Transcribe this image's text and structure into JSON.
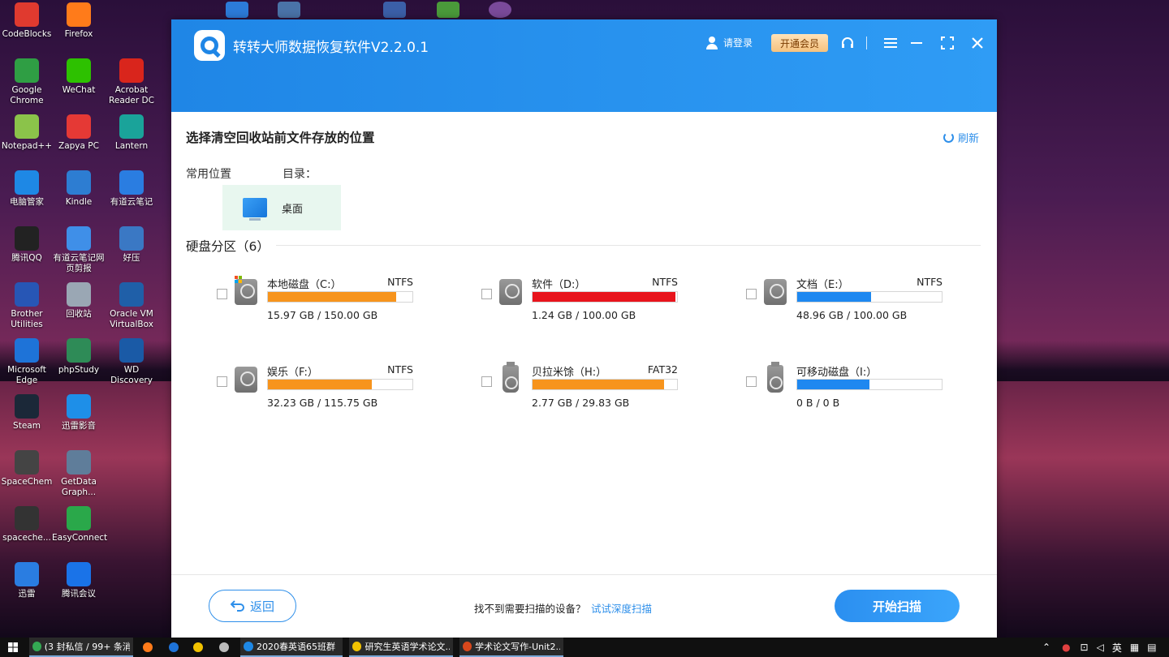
{
  "desktop": {
    "icons": [
      {
        "label": "CodeBlocks",
        "color": "#e03a2f"
      },
      {
        "label": "Firefox",
        "color": "#ff7b1a"
      },
      {
        "label": "Google Chrome",
        "color": "#2f9e44"
      },
      {
        "label": "WeChat",
        "color": "#2dc100"
      },
      {
        "label": "Acrobat Reader DC",
        "color": "#d9251c"
      },
      {
        "label": "Notepad++",
        "color": "#8bc34a"
      },
      {
        "label": "Zapya PC",
        "color": "#e53935"
      },
      {
        "label": "Lantern",
        "color": "#1aa39a"
      },
      {
        "label": "电脑管家",
        "color": "#1e88e5"
      },
      {
        "label": "Kindle",
        "color": "#2d7dd2"
      },
      {
        "label": "有道云笔记",
        "color": "#2a7de1"
      },
      {
        "label": "腾讯QQ",
        "color": "#222222"
      },
      {
        "label": "有道云笔记网页剪报",
        "color": "#3f8fe8"
      },
      {
        "label": "好压",
        "color": "#3a78c4"
      },
      {
        "label": "Brother Utilities",
        "color": "#2756b5"
      },
      {
        "label": "回收站",
        "color": "#9aa7b4"
      },
      {
        "label": "Oracle VM VirtualBox",
        "color": "#1f5fa8"
      },
      {
        "label": "Microsoft Edge",
        "color": "#1e73d8"
      },
      {
        "label": "phpStudy",
        "color": "#2e8b57"
      },
      {
        "label": "WD Discovery",
        "color": "#1a5aa6"
      },
      {
        "label": "Steam",
        "color": "#1b2838"
      },
      {
        "label": "迅雷影音",
        "color": "#1e8fe8"
      },
      {
        "label": "SpaceChem",
        "color": "#444444"
      },
      {
        "label": "GetData Graph...",
        "color": "#5f7d9a"
      },
      {
        "label": "spaceche...",
        "color": "#333333"
      },
      {
        "label": "EasyConnect",
        "color": "#2aa84a"
      },
      {
        "label": "迅雷",
        "color": "#2a7de1"
      },
      {
        "label": "腾讯会议",
        "color": "#1a73e8"
      }
    ]
  },
  "app": {
    "title": "转转大师数据恢复软件V2.2.0.1",
    "login_label": "请登录",
    "vip_label": "开通会员",
    "section_title": "选择清空回收站前文件存放的位置",
    "refresh_label": "刷新",
    "common_label": "常用位置",
    "dir_label": "目录：",
    "desktop_tile": "桌面",
    "disk_header": "硬盘分区（6）",
    "drives": [
      {
        "name": "本地磁盘（C:）",
        "fs": "NTFS",
        "size": "15.97 GB / 150.00 GB",
        "fill": 0.89,
        "color": "#f7941d",
        "type": "os"
      },
      {
        "name": "软件（D:）",
        "fs": "NTFS",
        "size": "1.24 GB / 100.00 GB",
        "fill": 0.988,
        "color": "#e8141c",
        "type": "hdd"
      },
      {
        "name": "文档（E:）",
        "fs": "NTFS",
        "size": "48.96 GB / 100.00 GB",
        "fill": 0.51,
        "color": "#1e88f0",
        "type": "hdd"
      },
      {
        "name": "娱乐（F:）",
        "fs": "NTFS",
        "size": "32.23 GB / 115.75 GB",
        "fill": 0.72,
        "color": "#f7941d",
        "type": "hdd"
      },
      {
        "name": "贝拉米馀（H:）",
        "fs": "FAT32",
        "size": "2.77 GB / 29.83 GB",
        "fill": 0.91,
        "color": "#f7941d",
        "type": "usb"
      },
      {
        "name": "可移动磁盘（I:）",
        "fs": "",
        "size": "0 B / 0 B",
        "fill": 0.5,
        "color": "#1e88f0",
        "type": "usb"
      }
    ],
    "back_label": "返回",
    "hint_text": "找不到需要扫描的设备？",
    "deep_scan_link": "试试深度扫描",
    "scan_button": "开始扫描"
  },
  "taskbar": {
    "items": [
      {
        "label": "(3 封私信 / 99+ 条消...",
        "color": "#34a853"
      },
      {
        "label": "",
        "color": "#ff7b1a"
      },
      {
        "label": "",
        "color": "#1e73d8"
      },
      {
        "label": "",
        "color": "#f2c200"
      },
      {
        "label": "",
        "color": "#bbbbbb"
      },
      {
        "label": "2020春英语65班群",
        "color": "#1e88e5"
      },
      {
        "label": "研究生英语学术论文...",
        "color": "#f2c200"
      },
      {
        "label": "学术论文写作-Unit2....",
        "color": "#d9481c"
      }
    ],
    "ime": "英"
  }
}
